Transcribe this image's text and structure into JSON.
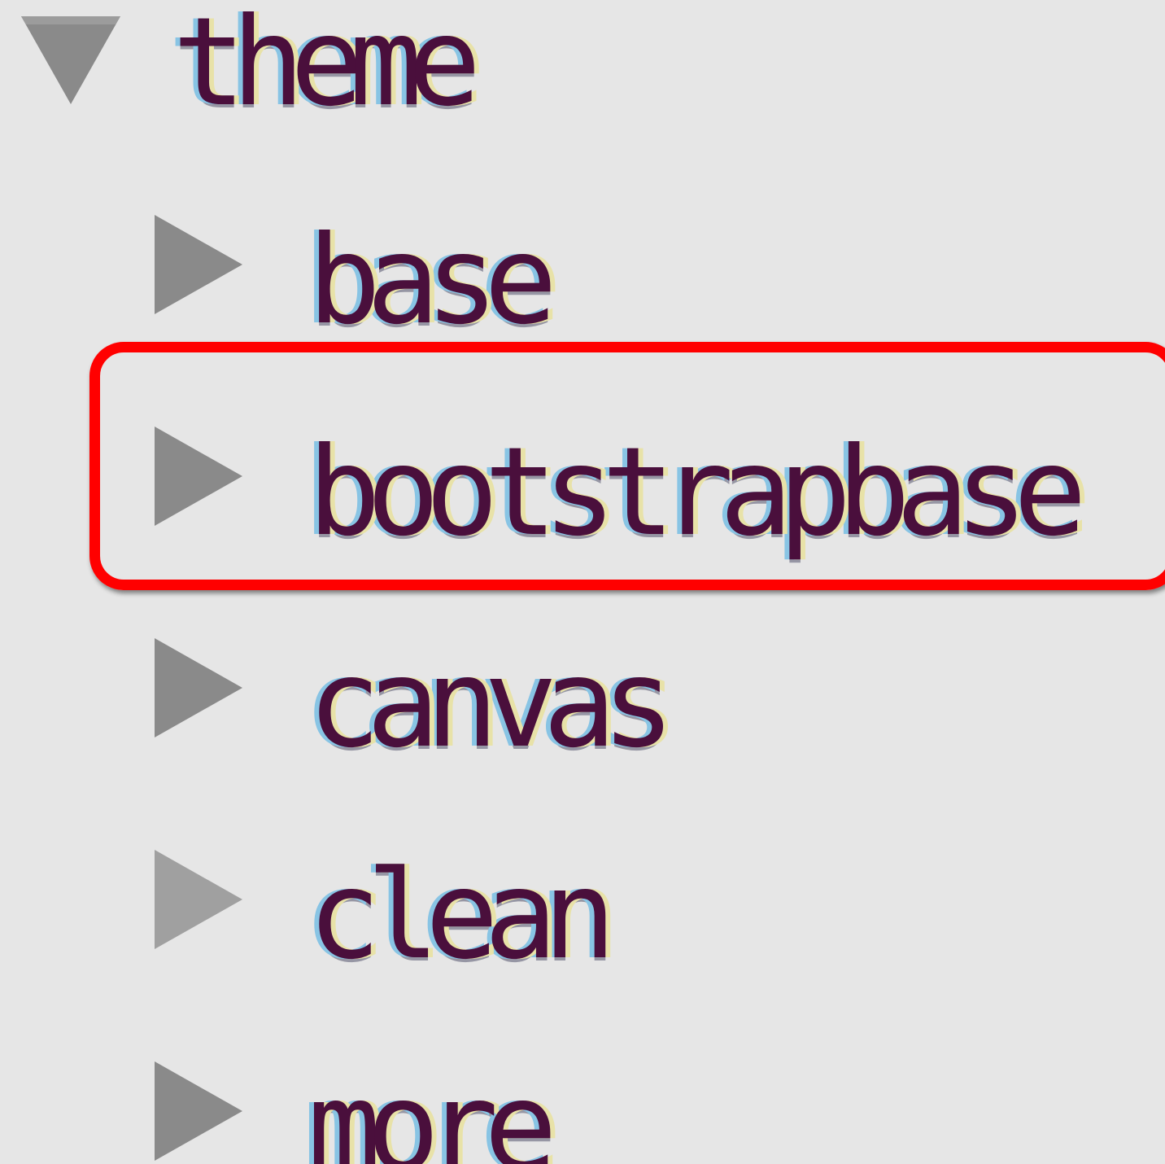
{
  "tree": {
    "root": {
      "label": "theme",
      "expanded": true,
      "icon": "triangle-down-icon"
    },
    "children": [
      {
        "label": "base",
        "expanded": false,
        "icon": "triangle-right-icon"
      },
      {
        "label": "bootstrapbase",
        "expanded": false,
        "icon": "triangle-right-icon",
        "highlighted": true
      },
      {
        "label": "canvas",
        "expanded": false,
        "icon": "triangle-right-icon"
      },
      {
        "label": "clean",
        "expanded": false,
        "icon": "triangle-right-icon"
      },
      {
        "label": "more",
        "expanded": false,
        "icon": "triangle-right-icon"
      }
    ]
  },
  "colors": {
    "background": "#e6e6e6",
    "toggle": "#8a8a8a",
    "highlight": "#ff0000"
  }
}
